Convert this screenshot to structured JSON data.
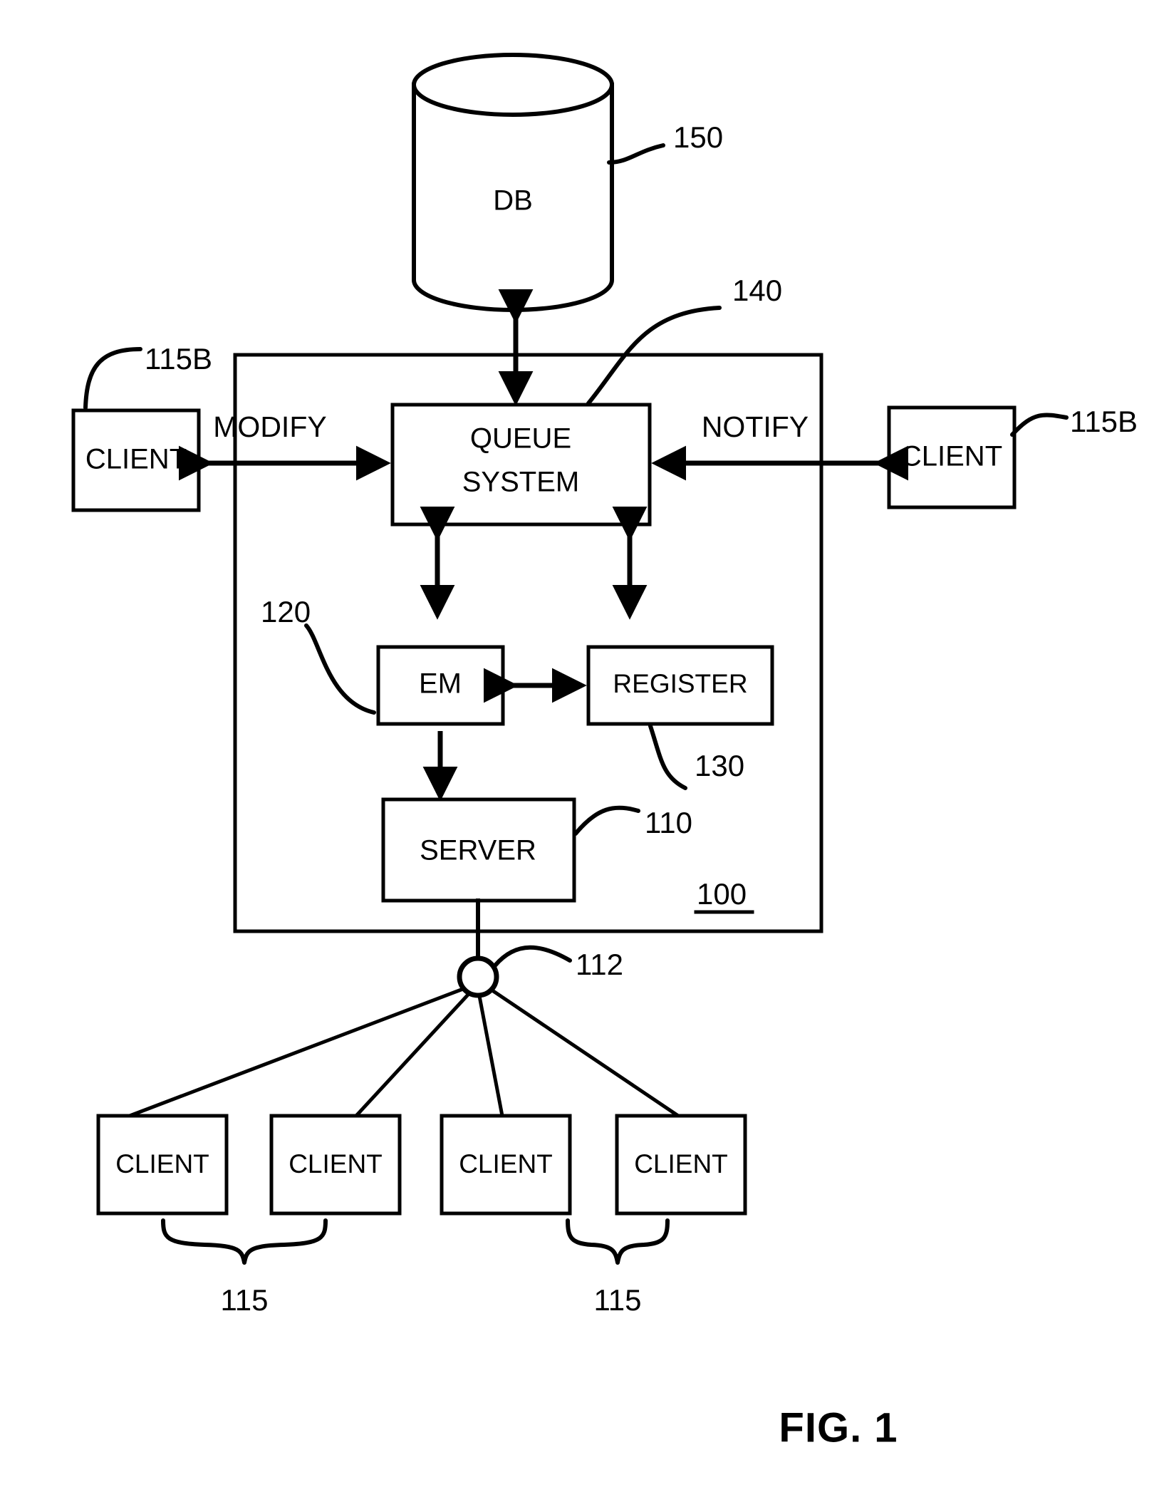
{
  "figure": {
    "caption": "FIG. 1",
    "system_ref": "100"
  },
  "database": {
    "label": "DB",
    "ref": "150"
  },
  "queue_system": {
    "label_line1": "QUEUE",
    "label_line2": "SYSTEM",
    "ref": "140"
  },
  "flows": {
    "modify": "MODIFY",
    "notify": "NOTIFY"
  },
  "em": {
    "label": "EM",
    "ref": "120"
  },
  "register": {
    "label": "REGISTER",
    "ref": "130"
  },
  "server": {
    "label": "SERVER",
    "ref": "110"
  },
  "hub": {
    "ref": "112"
  },
  "side_clients": [
    {
      "label": "CLIENT",
      "ref": "115B",
      "side": "left"
    },
    {
      "label": "CLIENT",
      "ref": "115B",
      "side": "right"
    }
  ],
  "bottom_clients": [
    {
      "label": "CLIENT"
    },
    {
      "label": "CLIENT"
    },
    {
      "label": "CLIENT"
    },
    {
      "label": "CLIENT"
    }
  ],
  "bottom_client_group_refs": [
    "115",
    "115"
  ],
  "colors": {
    "ink": "#000000",
    "paper": "#ffffff"
  }
}
